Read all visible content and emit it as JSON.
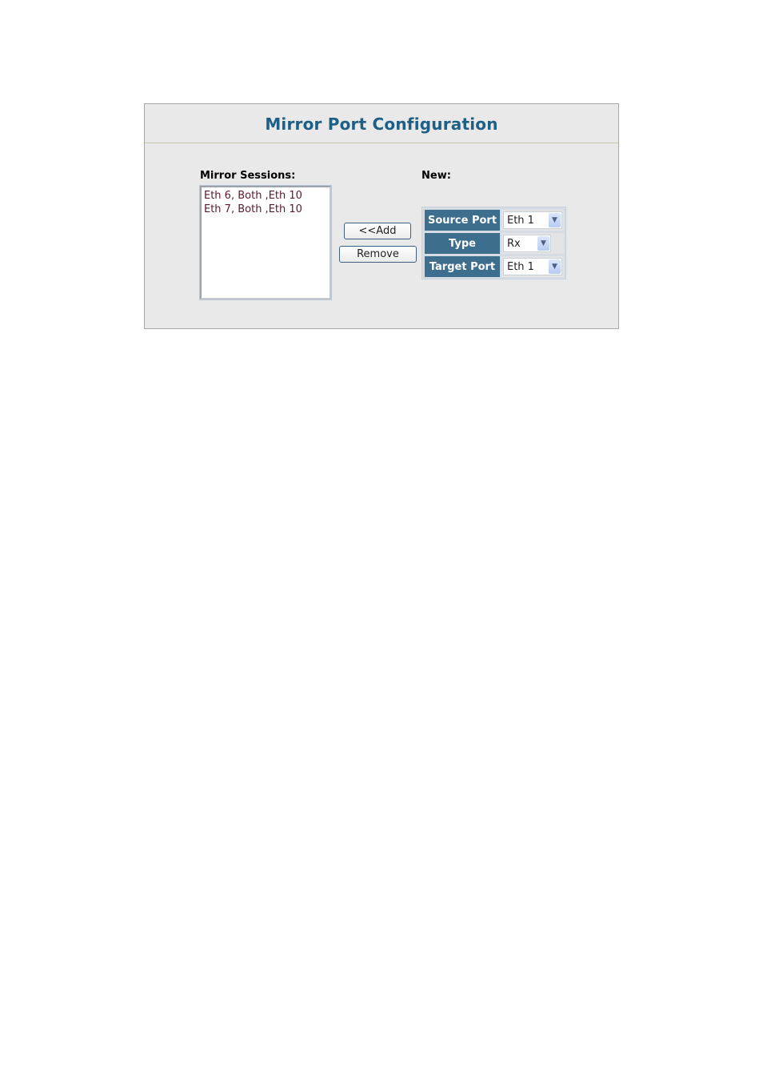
{
  "page": {
    "title": "Mirror Port Configuration"
  },
  "sessions": {
    "label": "Mirror Sessions:",
    "items": [
      "Eth 6, Both ,Eth 10",
      "Eth 7, Both ,Eth 10"
    ]
  },
  "buttons": {
    "add_label": "<<Add",
    "remove_label": "Remove"
  },
  "new": {
    "label": "New:",
    "fields": [
      {
        "label": "Source Port",
        "value": "Eth 1"
      },
      {
        "label": "Type",
        "value": "Rx"
      },
      {
        "label": "Target Port",
        "value": "Eth 1"
      }
    ]
  },
  "icons": {
    "dropdown": "chevron-down-icon",
    "dropdown_glyph": "⌄"
  }
}
